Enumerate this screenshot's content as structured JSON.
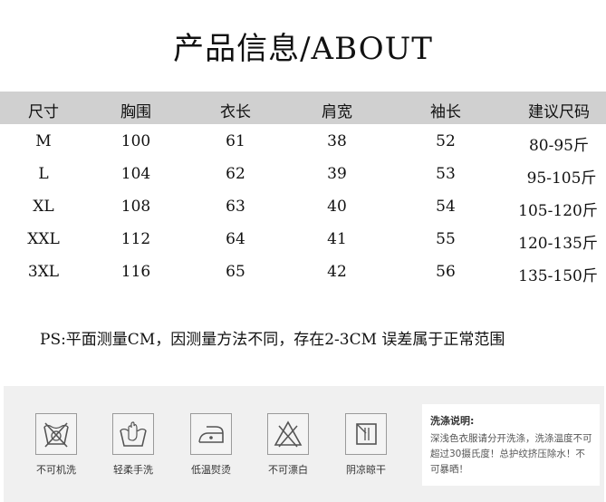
{
  "title": "产品信息/ABOUT",
  "table": {
    "headers": [
      "尺寸",
      "胸围",
      "衣长",
      "肩宽",
      "袖长",
      "建议尺码"
    ],
    "rows": [
      [
        "M",
        "100",
        "61",
        "38",
        "52",
        "80-95斤"
      ],
      [
        "L",
        "104",
        "62",
        "39",
        "53",
        "95-105斤"
      ],
      [
        "XL",
        "108",
        "63",
        "40",
        "54",
        "105-120斤"
      ],
      [
        "XXL",
        "112",
        "64",
        "41",
        "55",
        "120-135斤"
      ],
      [
        "3XL",
        "116",
        "65",
        "42",
        "56",
        "135-150斤"
      ]
    ]
  },
  "note": "PS:平面测量CM，因测量方法不同，存在2-3CM 误差属于正常范围",
  "care": {
    "items": [
      {
        "icon": "no-machine-wash-icon",
        "label": "不可机洗"
      },
      {
        "icon": "hand-wash-icon",
        "label": "轻柔手洗"
      },
      {
        "icon": "low-temp-iron-icon",
        "label": "低温熨烫"
      },
      {
        "icon": "no-bleach-icon",
        "label": "不可漂白"
      },
      {
        "icon": "shade-dry-icon",
        "label": "阴凉晾干"
      }
    ],
    "wash_title": "洗涤说明:",
    "wash_text": "深浅色衣服请分开洗涤，洗涤温度不可超过30摄氏度！总护纹挤压除水！不可暴晒！"
  }
}
